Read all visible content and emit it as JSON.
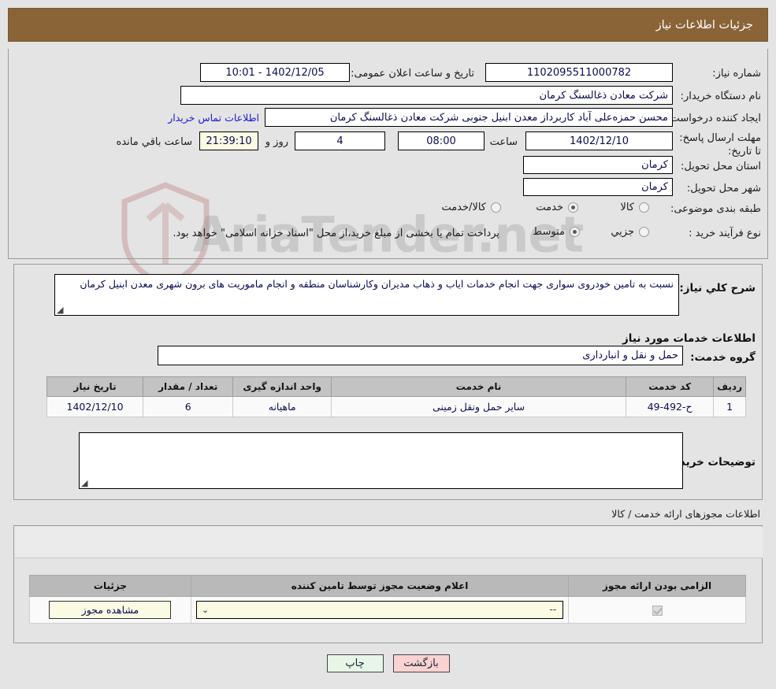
{
  "header": {
    "title": "جزئیات اطلاعات نیاز"
  },
  "form": {
    "need_number_label": "شماره نیاز:",
    "need_number_value": "1102095511000782",
    "announce_label": "تاریخ و ساعت اعلان عمومی:",
    "announce_value": "1402/12/05 - 10:01",
    "buyer_org_label": "نام دستگاه خریدار:",
    "buyer_org_value": "شرکت معادن ذغالسنگ کرمان",
    "creator_label": "ایجاد کننده درخواست:",
    "creator_value": "محسن حمزه‌علی آباد کاربرداز معدن ابنیل جنوبی شرکت معادن ذغالسنگ کرمان",
    "contact_link": "اطلاعات تماس خریدار",
    "deadline_label": "مهلت ارسال پاسخ: تا تاریخ:",
    "deadline_date": "1402/12/10",
    "hour_label": "ساعت",
    "deadline_time": "08:00",
    "days_value": "4",
    "days_label": "روز و",
    "remaining_time": "21:39:10",
    "remaining_label": "ساعت باقي مانده",
    "province_label": "استان محل تحویل:",
    "province_value": "کرمان",
    "city_label": "شهر محل تحویل:",
    "city_value": "کرمان",
    "classification_label": "طبقه بندی موضوعی:",
    "classification_options": [
      {
        "label": "کالا",
        "selected": false
      },
      {
        "label": "خدمت",
        "selected": true
      },
      {
        "label": "کالا/خدمت",
        "selected": false
      }
    ],
    "process_label": "نوع فرآیند خرید :",
    "process_options": [
      {
        "label": "جزیي",
        "selected": false
      },
      {
        "label": "متوسط",
        "selected": true
      }
    ],
    "process_note": "پرداخت تمام یا بخشی از مبلغ خرید،از محل \"اسناد خزانه اسلامی\" خواهد بود."
  },
  "details": {
    "need_desc_label": "شرح کلي نیاز:",
    "need_desc_value": "نسبت به تامین خودروی سواری جهت انجام خدمات ایاب و ذهاب مدیران وکارشناسان منطقه و انجام ماموریت های برون شهری معدن ابنیل  کرمان",
    "services_info_title": "اطلاعات خدمات مورد نیاز",
    "service_group_label": "گروه خدمت:",
    "service_group_value": "حمل و نقل و انبارداری",
    "buyer_notes_label": "توضیحات خریدار:",
    "buyer_notes_value": ""
  },
  "service_table": {
    "columns": [
      "ردیف",
      "کد خدمت",
      "نام خدمت",
      "واحد اندازه گیری",
      "تعداد / مقدار",
      "تاریخ نیاز"
    ],
    "rows": [
      [
        "1",
        "ح-492-49",
        "سایر حمل ونقل زمینی",
        "ماهیانه",
        "6",
        "1402/12/10"
      ]
    ]
  },
  "license": {
    "section_title": "اطلاعات مجوزهای ارائه خدمت / کالا",
    "columns": [
      "الزامی بودن ارائه مجوز",
      "اعلام وضعیت مجوز توسط تامین کننده",
      "جزئیات"
    ],
    "rows": [
      {
        "required": true,
        "status": "--",
        "detail_button": "مشاهده مجوز"
      }
    ]
  },
  "footer": {
    "print_label": "چاپ",
    "back_label": "بازگشت"
  },
  "watermark": {
    "text": "AriaTender.net"
  },
  "colors": {
    "header_brown": "#8a6337",
    "page_bg": "#e4e4e4",
    "link_blue": "#1919d8",
    "field_text": "#0c0c55",
    "print_green": "#e7f6e7",
    "back_pink": "#fbd2d2"
  }
}
